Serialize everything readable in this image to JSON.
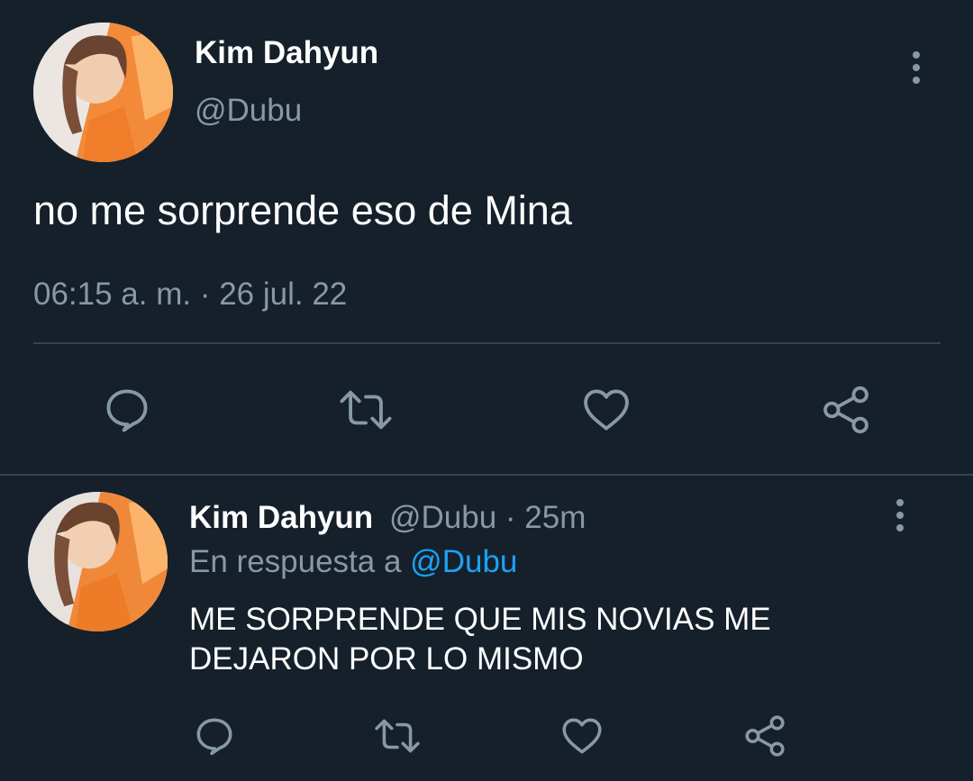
{
  "main_tweet": {
    "author_name": "Kim Dahyun",
    "author_handle": "@Dubu",
    "text": "no me sorprende eso de Mina",
    "timestamp": "06:15 a. m. · 26 jul. 22",
    "avatar_icon": "user-avatar-photo",
    "more_icon": "more-vertical-icon",
    "actions": [
      "reply-icon",
      "retweet-icon",
      "like-icon",
      "share-icon"
    ]
  },
  "reply_tweet": {
    "author_name": "Kim Dahyun",
    "author_meta": "@Dubu · 25m",
    "reply_prefix": "En respuesta a",
    "reply_to": "@Dubu",
    "text_line1": "ME SORPRENDE QUE MIS NOVIAS ME",
    "text_line2": "DEJARON POR LO MISMO",
    "avatar_icon": "user-avatar-photo",
    "more_icon": "more-vertical-icon",
    "actions": [
      "reply-icon",
      "retweet-icon",
      "like-icon",
      "share-icon"
    ]
  },
  "colors": {
    "background": "#15202b",
    "text": "#ffffff",
    "muted": "#8899a6",
    "link": "#1da1f2",
    "divider": "#38444d"
  }
}
